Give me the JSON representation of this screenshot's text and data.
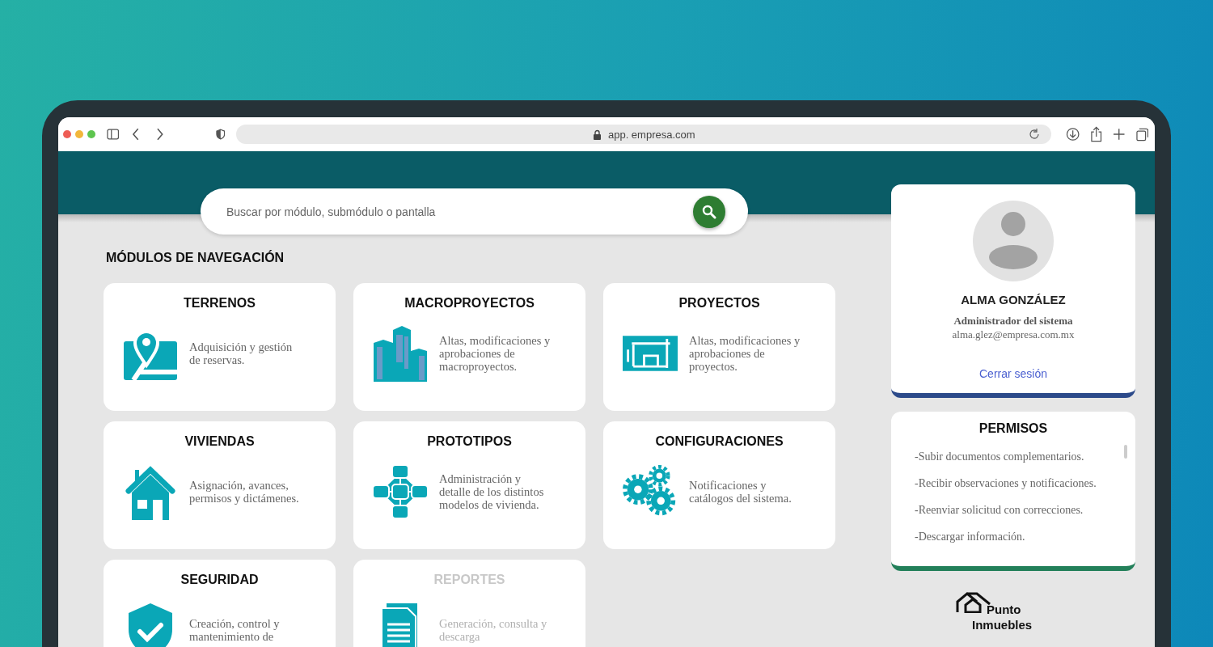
{
  "browser": {
    "url": "app. empresa.com"
  },
  "search": {
    "placeholder": "Buscar por módulo, submódulo o pantalla"
  },
  "section_title": "MÓDULOS DE NAVEGACIÓN",
  "modules": [
    {
      "title": "TERRENOS",
      "description": "Adquisición y gestión de reservas.",
      "kind": "map",
      "disabled": false
    },
    {
      "title": "MACROPROYECTOS",
      "description": "Altas, modificaciones y aprobaciones de macroproyectos.",
      "kind": "buildings",
      "disabled": false
    },
    {
      "title": "PROYECTOS",
      "description": "Altas, modificaciones y aprobaciones de proyectos.",
      "kind": "blueprint",
      "disabled": false
    },
    {
      "title": "VIVIENDAS",
      "description": "Asignación, avances, permisos y dictámenes.",
      "kind": "house",
      "disabled": false
    },
    {
      "title": "PROTOTIPOS",
      "description": "Administración y detalle de los distintos modelos de vivienda.",
      "kind": "network",
      "disabled": false
    },
    {
      "title": "CONFIGURACIONES",
      "description": "Notificaciones y catálogos del sistema.",
      "kind": "gears",
      "disabled": false
    },
    {
      "title": "SEGURIDAD",
      "description": "Creación, control y mantenimiento de",
      "kind": "shield",
      "disabled": false
    },
    {
      "title": "REPORTES",
      "description": "Generación, consulta y descarga",
      "kind": "document",
      "disabled": true
    }
  ],
  "profile": {
    "name": "ALMA GONZÁLEZ",
    "role": "Administrador del sistema",
    "email": "alma.glez@empresa.com.mx",
    "logout": "Cerrar sesión"
  },
  "permissions": {
    "title": "PERMISOS",
    "items": [
      "-Subir documentos complementarios.",
      "-Recibir observaciones y notificaciones.",
      "-Reenviar solicitud con correcciones.",
      "-Descargar información."
    ]
  },
  "logo": {
    "line_1": "Punto",
    "line_2": "Inmuebles"
  }
}
